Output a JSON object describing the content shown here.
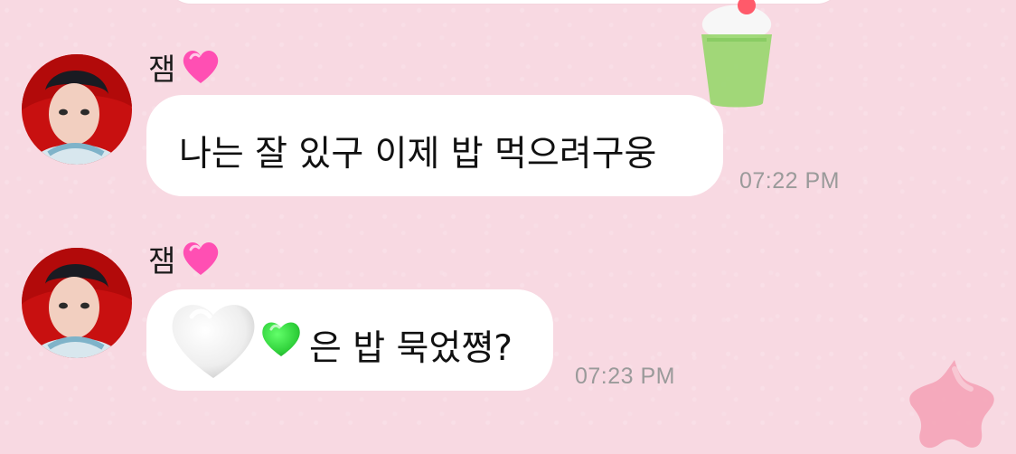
{
  "messages": [
    {
      "sender": "잼",
      "sender_emoji": "pink-heart-icon",
      "text": "나는 잘 있구 이제 밥 먹으려구웅",
      "time": "07:22 PM"
    },
    {
      "sender": "잼",
      "sender_emoji": "pink-heart-icon",
      "text": "은 밥 묵었쪙?",
      "emojis": [
        "white-heart-icon",
        "green-heart-icon"
      ],
      "time": "07:23 PM"
    }
  ],
  "colors": {
    "background": "#f8d9e2",
    "bubble": "#ffffff",
    "time": "#9a9a9a",
    "pink_heart": "#ff4fb3",
    "green_heart": "#2fd03a",
    "white_heart": "#f2f2f2"
  },
  "decor": [
    "melon-soda-sticker",
    "pink-star-sticker"
  ]
}
